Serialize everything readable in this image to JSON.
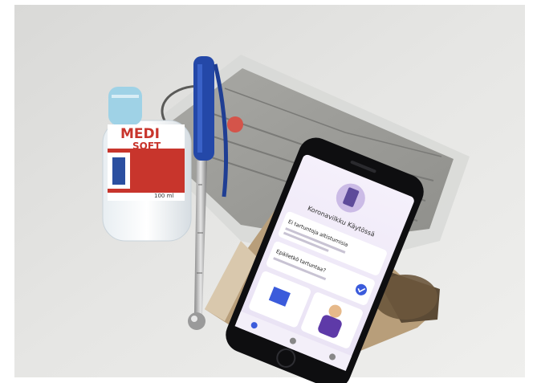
{
  "scene": {
    "objects": [
      "hand-sanitizer-bottle",
      "telescopic-pointer-pen",
      "face-mask-in-plastic-bag",
      "smartphone",
      "wooden-phone-case"
    ]
  },
  "sanitizer": {
    "brand_line1": "MEDI",
    "brand_line2": "SOFT",
    "volume": "100 ml",
    "label_color": "#c8352c",
    "cap_color": "#9fd2e6"
  },
  "phone_app": {
    "header_title": "Koronavilkku Käytössä",
    "card1_title": "Ei tartuntoja altistumisia",
    "card2_title": "Epäiletkö tartuntaa?",
    "check_color": "#3b5bdb",
    "bg_color": "#efe9f7"
  }
}
